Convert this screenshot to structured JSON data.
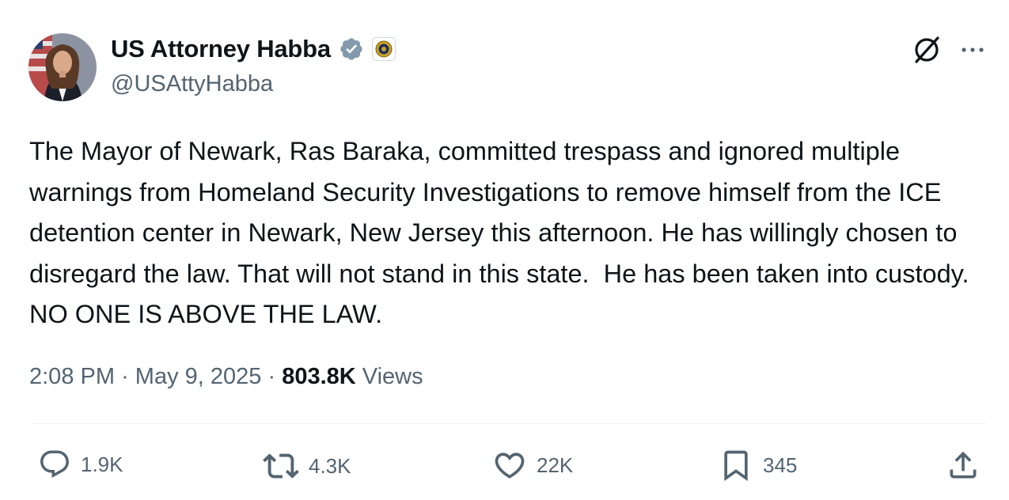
{
  "author": {
    "display_name": "US Attorney Habba",
    "handle": "@USAttyHabba",
    "verified_badge_color": "#829aab"
  },
  "tweet": {
    "text": "The Mayor of Newark, Ras Baraka, committed trespass and ignored multiple warnings from Homeland Security Investigations to remove himself from the ICE detention center in Newark, New Jersey this afternoon. He has willingly chosen to disregard the law. That will not stand in this state.  He has been taken into custody. NO ONE IS ABOVE THE LAW."
  },
  "meta": {
    "time": "2:08 PM",
    "separator": "·",
    "date": "May 9, 2025",
    "views_count": "803.8K",
    "views_label": "Views"
  },
  "actions": {
    "reply_count": "1.9K",
    "repost_count": "4.3K",
    "like_count": "22K",
    "bookmark_count": "345"
  },
  "icons": [
    "grok-icon",
    "more-icon",
    "verified-icon",
    "affiliate-seal-icon",
    "reply-icon",
    "repost-icon",
    "like-icon",
    "bookmark-icon",
    "share-icon"
  ],
  "colors": {
    "text": "#0f1419",
    "secondary": "#536471",
    "divider": "#eff3f4"
  }
}
